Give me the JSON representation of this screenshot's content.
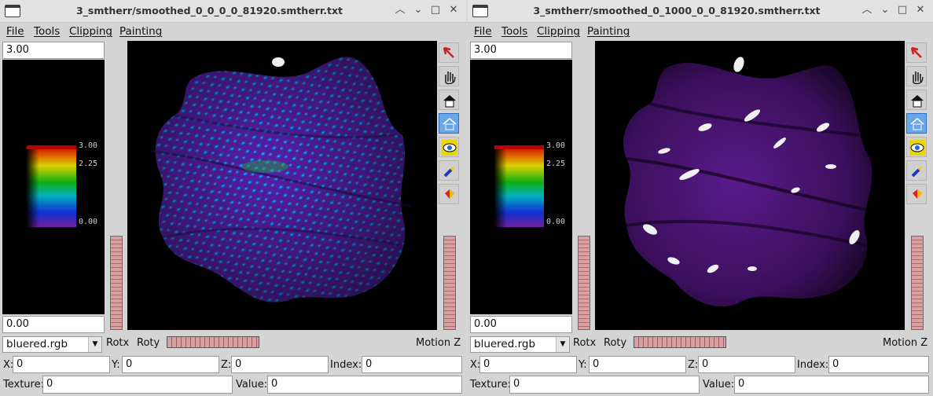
{
  "windows": [
    {
      "title": "3_smtherr/smoothed_0_0_0_0_81920.smtherr.txt",
      "menu": [
        "File",
        "Tools",
        "Clipping",
        "Painting"
      ],
      "max_value": "3.00",
      "min_value": "0.00",
      "scale_ticks": [
        "3.00",
        "2.25",
        "0.00"
      ],
      "colormap_select": "bluered.rgb",
      "labels": {
        "rotx": "Rotx",
        "roty": "Roty",
        "motionz": "Motion Z"
      },
      "coords": {
        "x_label": "X:",
        "x": "0",
        "y_label": "Y:",
        "y": "0",
        "z_label": "Z:",
        "z": "0",
        "index_label": "Index:",
        "index": "0",
        "texture_label": "Texture:",
        "texture": "0",
        "value_label": "Value:",
        "value": "0"
      },
      "tools": [
        "pointer-icon",
        "hand-icon",
        "house-icon",
        "home-view-icon",
        "eye-icon",
        "flashlight-icon",
        "paint-icon"
      ]
    },
    {
      "title": "3_smtherr/smoothed_0_1000_0_0_81920.smtherr.txt",
      "menu": [
        "File",
        "Tools",
        "Clipping",
        "Painting"
      ],
      "max_value": "3.00",
      "min_value": "0.00",
      "scale_ticks": [
        "3.00",
        "2.25",
        "0.00"
      ],
      "colormap_select": "bluered.rgb",
      "labels": {
        "rotx": "Rotx",
        "roty": "Roty",
        "motionz": "Motion Z"
      },
      "coords": {
        "x_label": "X:",
        "x": "0",
        "y_label": "Y:",
        "y": "0",
        "z_label": "Z:",
        "z": "0",
        "index_label": "Index:",
        "index": "0",
        "texture_label": "Texture:",
        "texture": "0",
        "value_label": "Value:",
        "value": "0"
      },
      "tools": [
        "pointer-icon",
        "hand-icon",
        "house-icon",
        "home-view-icon",
        "eye-icon",
        "flashlight-icon",
        "paint-icon"
      ]
    }
  ],
  "window_controls": {
    "minimize": "⌄",
    "maximize": "□",
    "close": "✕",
    "shade": "︿"
  }
}
